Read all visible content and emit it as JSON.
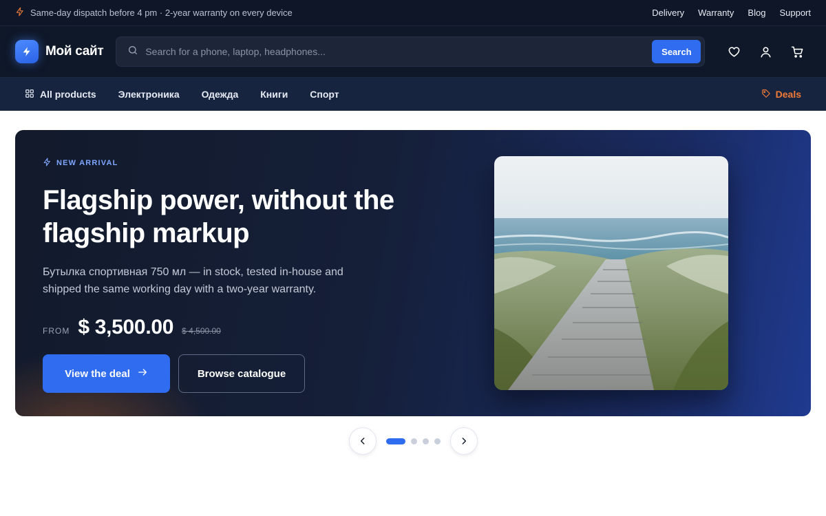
{
  "topbar": {
    "announcement": "Same-day dispatch before 4 pm · 2-year warranty on every device",
    "links": [
      "Delivery",
      "Warranty",
      "Blog",
      "Support"
    ]
  },
  "header": {
    "logo_text": "Мой сайт",
    "search_placeholder": "Search for a phone, laptop, headphones...",
    "search_button": "Search",
    "icons": [
      "heart-icon",
      "user-icon",
      "cart-icon"
    ]
  },
  "nav": {
    "all_products": "All products",
    "categories": [
      "Электроника",
      "Одежда",
      "Книги",
      "Спорт"
    ],
    "deals": "Deals"
  },
  "hero": {
    "eyebrow": "NEW ARRIVAL",
    "title": "Flagship power, without the flagship markup",
    "description": "Бутылка спортивная 750 мл — in stock, tested in-house and shipped the same working day with a two-year warranty.",
    "price_from": "FROM",
    "price_now": "$ 3,500.00",
    "price_old": "$ 4,500.00",
    "cta_primary": "View the deal",
    "cta_secondary": "Browse catalogue"
  },
  "carousel": {
    "slide_count": 4,
    "active_index": 0
  },
  "colors": {
    "accent": "#2f6cf0",
    "deals": "#f17b36",
    "eyebrow": "#7fa6ff"
  }
}
